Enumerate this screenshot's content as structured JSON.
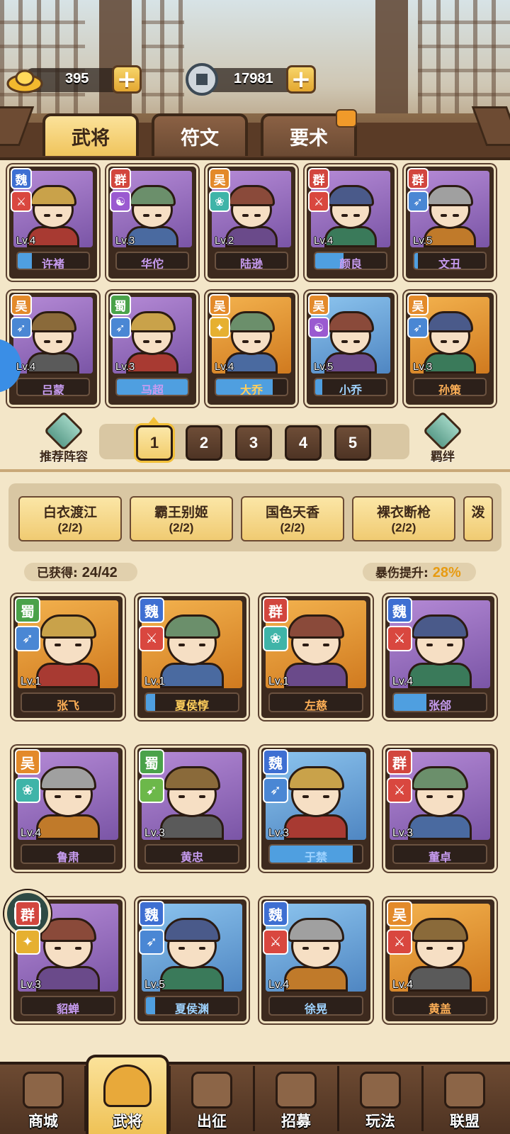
{
  "resources": [
    {
      "name": "gold",
      "icon": "gold-ingot-icon",
      "value": "395"
    },
    {
      "name": "coin",
      "icon": "copper-coin-icon",
      "value": "17981"
    }
  ],
  "tabs": [
    {
      "label": "武将",
      "active": true
    },
    {
      "label": "符文",
      "active": false
    },
    {
      "label": "要术",
      "active": false
    }
  ],
  "team": [
    {
      "name": "许褚",
      "faction": "魏",
      "level": "Lv.4",
      "portrait": "purple",
      "weapon": "red",
      "name_color": "purple",
      "fill": 0.2
    },
    {
      "name": "华佗",
      "faction": "群",
      "level": "Lv.3",
      "portrait": "purple",
      "weapon": "purple",
      "name_color": "purple",
      "fill": 0
    },
    {
      "name": "陆逊",
      "faction": "吴",
      "level": "Lv.2",
      "portrait": "purple",
      "weapon": "teal",
      "name_color": "purple",
      "fill": 0
    },
    {
      "name": "颜良",
      "faction": "群",
      "level": "Lv.4",
      "portrait": "purple",
      "weapon": "red",
      "name_color": "purple",
      "fill": 0.4
    },
    {
      "name": "文丑",
      "faction": "群",
      "level": "Lv.5",
      "portrait": "purple",
      "weapon": "blue",
      "name_color": "purple",
      "fill": 0.05
    },
    {
      "name": "吕蒙",
      "faction": "吴",
      "level": "Lv.4",
      "portrait": "purple",
      "weapon": "blue",
      "name_color": "purple",
      "fill": 0
    },
    {
      "name": "马超",
      "faction": "蜀",
      "level": "Lv.3",
      "portrait": "purple",
      "weapon": "blue",
      "name_color": "purple",
      "fill": 1
    },
    {
      "name": "大乔",
      "faction": "吴",
      "level": "Lv.4",
      "portrait": "orange",
      "weapon": "yellow",
      "name_color": "gold",
      "fill": 0.8
    },
    {
      "name": "小乔",
      "faction": "吴",
      "level": "Lv.5",
      "portrait": "blue",
      "weapon": "purple",
      "name_color": "blue",
      "fill": 0.1
    },
    {
      "name": "孙策",
      "faction": "吴",
      "level": "Lv.3",
      "portrait": "orange",
      "weapon": "blue",
      "name_color": "orange",
      "fill": 0
    }
  ],
  "recommend_label": "推荐阵容",
  "bond_label": "羁绊",
  "pages": [
    "1",
    "2",
    "3",
    "4",
    "5"
  ],
  "active_page": "1",
  "bond_sets": [
    {
      "title": "白衣渡江",
      "count": "(2/2)"
    },
    {
      "title": "霸王别姬",
      "count": "(2/2)"
    },
    {
      "title": "国色天香",
      "count": "(2/2)"
    },
    {
      "title": "裸衣断枪",
      "count": "(2/2)"
    },
    {
      "title": "泼",
      "count": ""
    }
  ],
  "obtained_label": "已获得:",
  "obtained_value": "24/42",
  "crit_label": "暴伤提升:",
  "crit_value": "28%",
  "collection": [
    {
      "name": "张飞",
      "faction": "蜀",
      "level": "Lv.1",
      "portrait": "orange",
      "weapon": "blue",
      "name_color": "orange",
      "fill": 0
    },
    {
      "name": "夏侯惇",
      "faction": "魏",
      "level": "Lv.1",
      "portrait": "orange",
      "weapon": "red",
      "name_color": "gold",
      "fill": 0.1
    },
    {
      "name": "左慈",
      "faction": "群",
      "level": "Lv.1",
      "portrait": "orange",
      "weapon": "teal",
      "name_color": "orange",
      "fill": 0
    },
    {
      "name": "张郃",
      "faction": "魏",
      "level": "Lv.4",
      "portrait": "purple",
      "weapon": "red",
      "name_color": "purple",
      "fill": 0.35
    },
    {
      "name": "鲁肃",
      "faction": "吴",
      "level": "Lv.4",
      "portrait": "purple",
      "weapon": "teal",
      "name_color": "purple",
      "fill": 0
    },
    {
      "name": "黄忠",
      "faction": "蜀",
      "level": "Lv.3",
      "portrait": "purple",
      "weapon": "green",
      "name_color": "purple",
      "fill": 0
    },
    {
      "name": "于禁",
      "faction": "魏",
      "level": "Lv.3",
      "portrait": "blue",
      "weapon": "blue",
      "name_color": "blue",
      "fill": 0.9
    },
    {
      "name": "董卓",
      "faction": "群",
      "level": "Lv.3",
      "portrait": "purple",
      "weapon": "red",
      "name_color": "purple",
      "fill": 0
    },
    {
      "name": "貂蝉",
      "faction": "群",
      "level": "Lv.3",
      "portrait": "purple",
      "weapon": "yellow",
      "name_color": "purple",
      "fill": 0
    },
    {
      "name": "夏侯渊",
      "faction": "魏",
      "level": "Lv.5",
      "portrait": "blue",
      "weapon": "blue",
      "name_color": "blue",
      "fill": 0.1
    },
    {
      "name": "徐晃",
      "faction": "魏",
      "level": "Lv.4",
      "portrait": "blue",
      "weapon": "red",
      "name_color": "blue",
      "fill": 0
    },
    {
      "name": "黄盖",
      "faction": "吴",
      "level": "Lv.4",
      "portrait": "orange",
      "weapon": "red",
      "name_color": "orange",
      "fill": 0
    }
  ],
  "nav": [
    {
      "label": "商城",
      "icon": "shop-icon"
    },
    {
      "label": "武将",
      "icon": "helmet-icon",
      "active": true
    },
    {
      "label": "出征",
      "icon": "march-icon"
    },
    {
      "label": "招募",
      "icon": "recruit-scroll-icon"
    },
    {
      "label": "玩法",
      "icon": "pavilion-icon"
    },
    {
      "label": "联盟",
      "icon": "alliance-icon"
    }
  ],
  "colors": {
    "accent": "#f0c45c",
    "dark": "#3d2818",
    "panel": "#f3e6c8"
  }
}
